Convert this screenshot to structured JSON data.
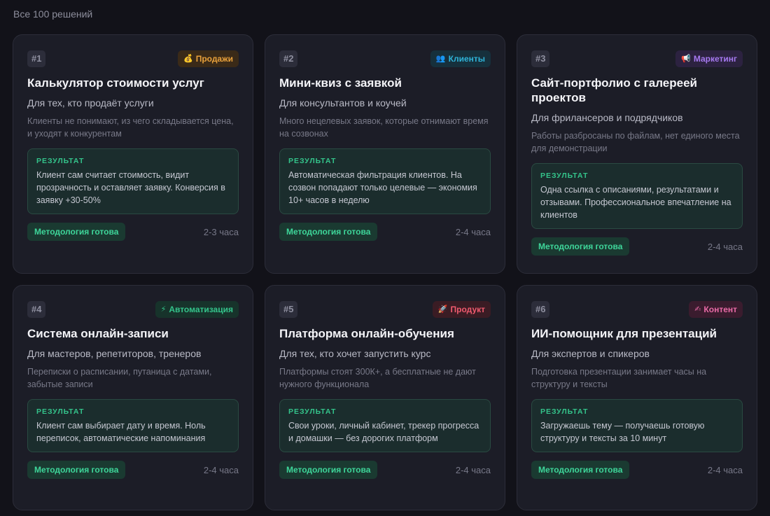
{
  "heading": "Все 100 решений",
  "result_label": "РЕЗУЛЬТАТ",
  "cards": [
    {
      "number": "#1",
      "tag": {
        "icon": "💰",
        "icon_name": "money-bag-icon",
        "label": "Продажи",
        "color": "#e9a13b",
        "bg": "#3a2a18"
      },
      "title": "Калькулятор стоимости услуг",
      "audience": "Для тех, кто продаёт услуги",
      "problem": "Клиенты не понимают, из чего складывается цена, и уходят к конкурентам",
      "result": "Клиент сам считает стоимость, видит прозрачность и оставляет заявку. Конверсия в заявку +30-50%",
      "status": "Методология готова",
      "duration": "2-3 часа"
    },
    {
      "number": "#2",
      "tag": {
        "icon": "👥",
        "icon_name": "people-icon",
        "label": "Клиенты",
        "color": "#2fb3d8",
        "bg": "#16303c"
      },
      "title": "Мини-квиз с заявкой",
      "audience": "Для консультантов и коучей",
      "problem": "Много нецелевых заявок, которые отнимают время на созвонах",
      "result": "Автоматическая фильтрация клиентов. На созвон попадают только целевые — экономия 10+ часов в неделю",
      "status": "Методология готова",
      "duration": "2-4 часа"
    },
    {
      "number": "#3",
      "tag": {
        "icon": "📢",
        "icon_name": "megaphone-icon",
        "label": "Маркетинг",
        "color": "#a679f0",
        "bg": "#2c2240"
      },
      "title": "Сайт-портфолио с галереей проектов",
      "audience": "Для фрилансеров и подрядчиков",
      "problem": "Работы разбросаны по файлам, нет единого места для демонстрации",
      "result": "Одна ссылка с описаниями, результатами и отзывами. Профессиональное впечатление на клиентов",
      "status": "Методология готова",
      "duration": "2-4 часа"
    },
    {
      "number": "#4",
      "tag": {
        "icon": "⚡",
        "icon_name": "lightning-icon",
        "label": "Автоматизация",
        "color": "#34c48b",
        "bg": "#17332b"
      },
      "title": "Система онлайн-записи",
      "audience": "Для мастеров, репетиторов, тренеров",
      "problem": "Переписки о расписании, путаница с датами, забытые записи",
      "result": "Клиент сам выбирает дату и время. Ноль переписок, автоматические напоминания",
      "status": "Методология готова",
      "duration": "2-4 часа"
    },
    {
      "number": "#5",
      "tag": {
        "icon": "🚀",
        "icon_name": "rocket-icon",
        "label": "Продукт",
        "color": "#ef5a6e",
        "bg": "#3a1c24"
      },
      "title": "Платформа онлайн-обучения",
      "audience": "Для тех, кто хочет запустить курс",
      "problem": "Платформы стоят 300К+, а бесплатные не дают нужного функционала",
      "result": "Свои уроки, личный кабинет, трекер прогресса и домашки — без дорогих платформ",
      "status": "Методология готова",
      "duration": "2-4 часа"
    },
    {
      "number": "#6",
      "tag": {
        "icon": "✍",
        "icon_name": "writing-hand-icon",
        "label": "Контент",
        "color": "#e86aa6",
        "bg": "#3a1c2e"
      },
      "title": "ИИ-помощник для презентаций",
      "audience": "Для экспертов и спикеров",
      "problem": "Подготовка презентации занимает часы на структуру и тексты",
      "result": "Загружаешь тему — получаешь готовую структуру и тексты за 10 минут",
      "status": "Методология готова",
      "duration": "2-4 часа"
    }
  ]
}
